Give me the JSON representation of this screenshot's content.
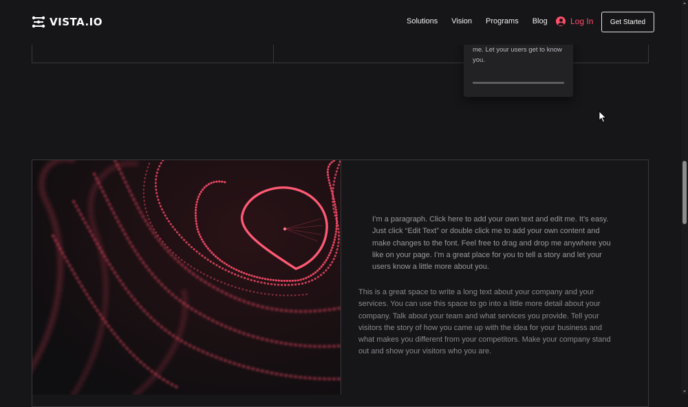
{
  "brand": {
    "name": "VISTA.IO",
    "logo_icon": "connected-nodes-icon",
    "accent_color": "#ff4d6a"
  },
  "nav": {
    "items": [
      {
        "label": "Solutions"
      },
      {
        "label": "Vision"
      },
      {
        "label": "Programs"
      },
      {
        "label": "Blog"
      }
    ],
    "login_label": "Log In",
    "login_icon": "user-circle-icon",
    "cta_label": "Get Started"
  },
  "floating_card": {
    "text": "me. Let your users get to know you."
  },
  "main_section": {
    "image_description_icon": "particle-wave-image",
    "paragraph_1": "I’m a paragraph. Click here to add your own text and edit me. It’s easy. Just click “Edit Text” or double click me to add your own content and make changes to the font. Feel free to drag and drop me anywhere you like on your page. I’m a great place for you to tell a story and let your users know a little more about you.",
    "paragraph_2": "This is a great space to write a long text about your company and your services. You can use this space to go into a little more detail about your company. Talk about your team and what services you provide. Tell your visitors the story of how you came up with the idea for your business and what makes you different from your competitors. Make your company stand out and show your visitors who you are."
  },
  "colors": {
    "background": "#161618",
    "border": "#3a3a3e",
    "particle": "#ff4d6a"
  }
}
